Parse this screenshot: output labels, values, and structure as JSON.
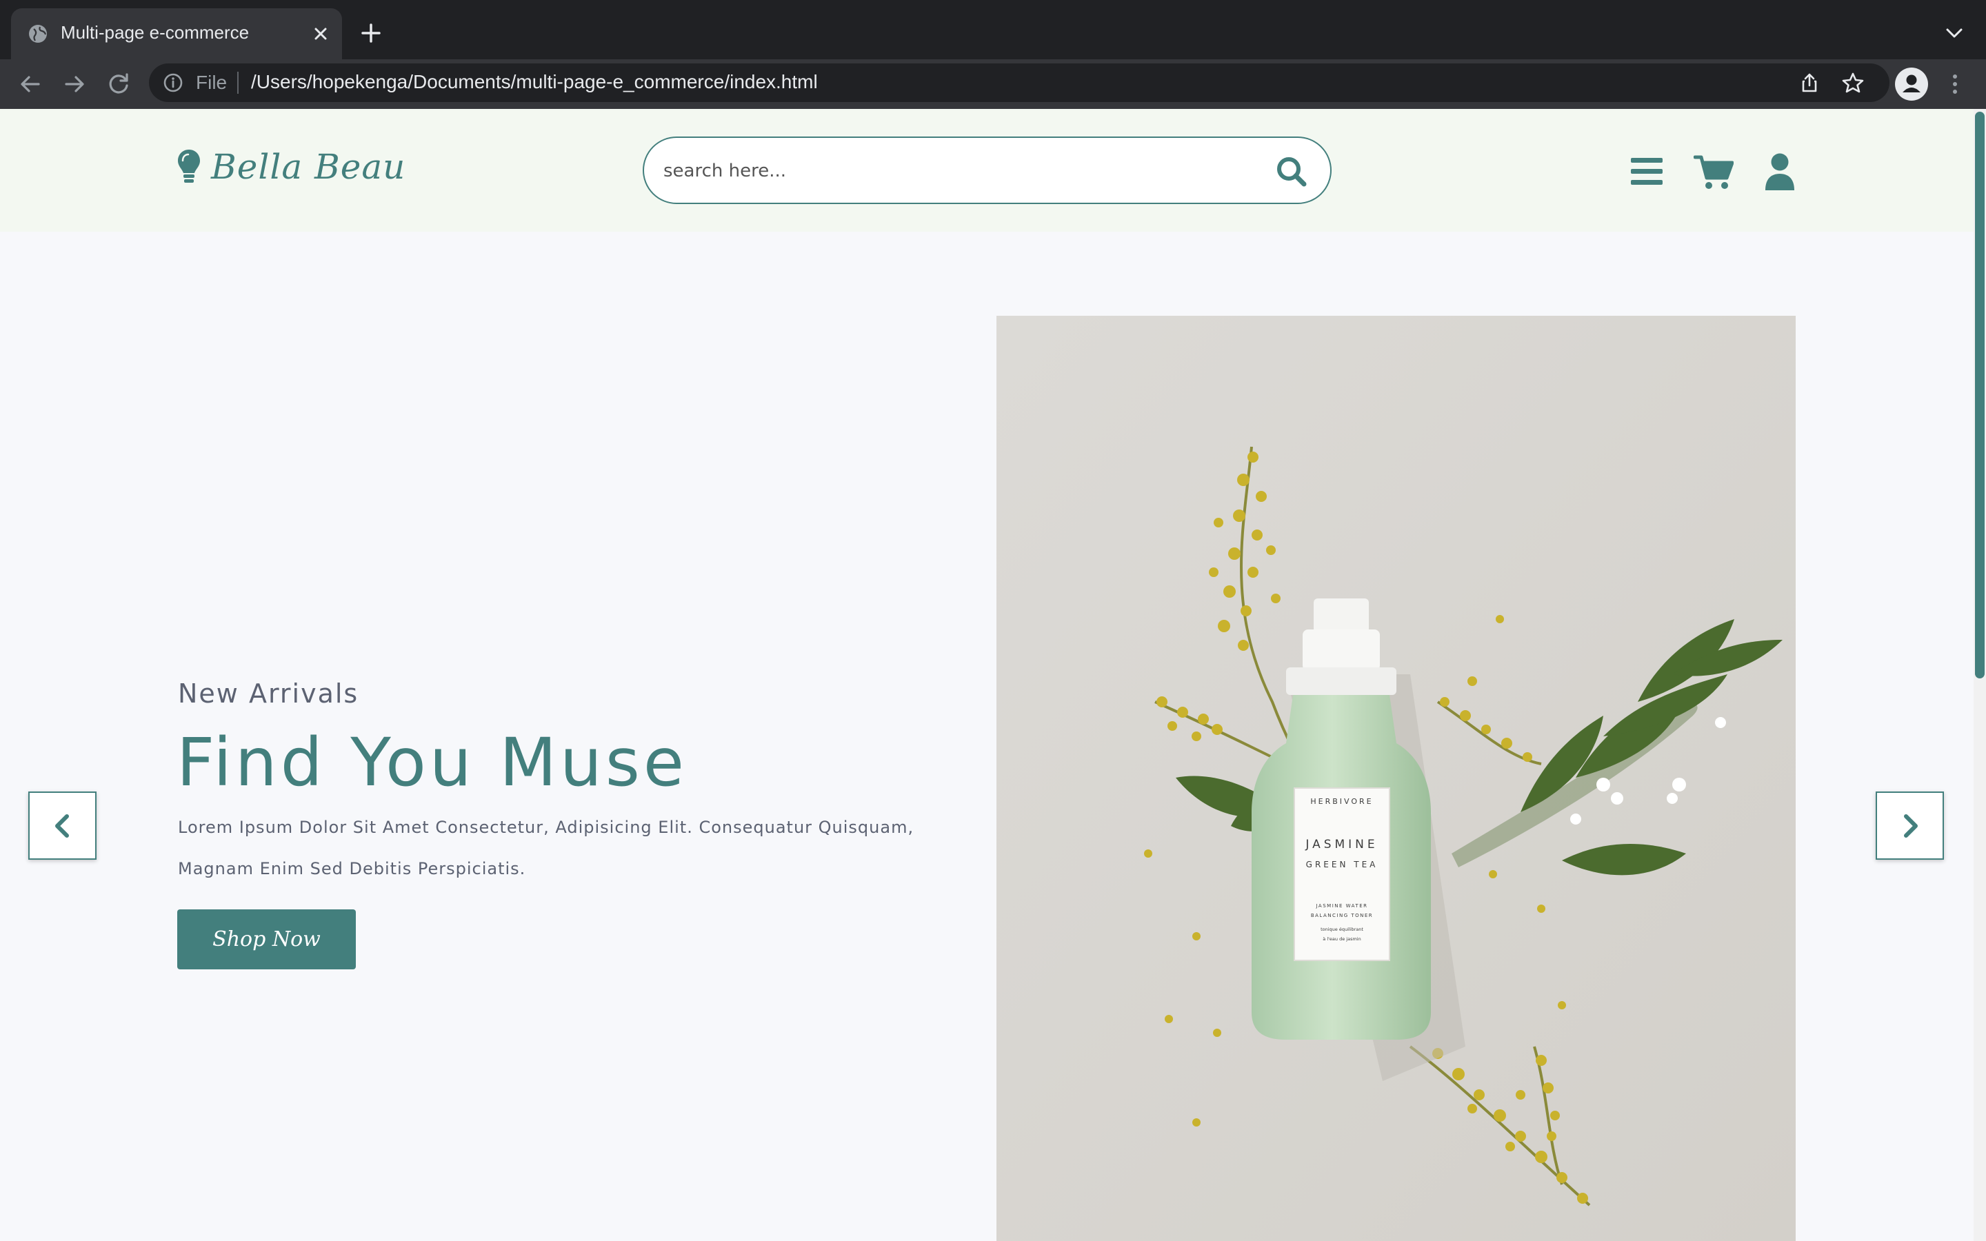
{
  "browser": {
    "tab_title": "Multi-page e-commerce",
    "url_scheme_label": "File",
    "url": "/Users/hopekenga/Documents/multi-page-e_commerce/index.html"
  },
  "site": {
    "brand": "Bella Beau",
    "search_placeholder": "search here...",
    "accent_color": "#437f7d",
    "header_bg": "#f3f8f1"
  },
  "hero": {
    "subtitle": "New Arrivals",
    "title": "Find You Muse",
    "description": "Lorem Ipsum Dolor Sit Amet Consectetur, Adipisicing Elit. Consequatur Quisquam, Magnam Enim Sed Debitis Perspiciatis.",
    "cta_label": "Shop Now",
    "product": {
      "brand": "HERBIVORE",
      "name_line1": "JASMINE",
      "name_line2": "GREEN TEA",
      "sub_line1": "JASMINE WATER",
      "sub_line2": "BALANCING TONER",
      "sub_line3": "tonique équilibrant",
      "sub_line4": "à l'eau de jasmin"
    }
  },
  "icons": {
    "header": [
      "menu-icon",
      "cart-icon",
      "user-icon"
    ],
    "slider": [
      "chevron-left-icon",
      "chevron-right-icon"
    ]
  }
}
